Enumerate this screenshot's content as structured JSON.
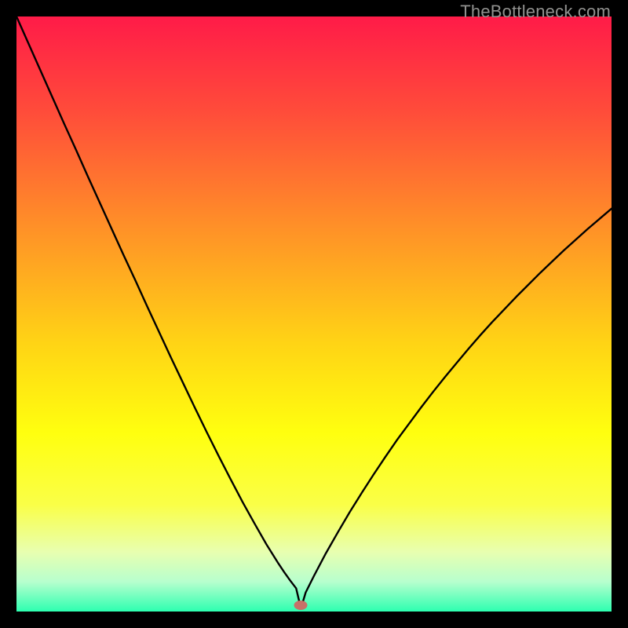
{
  "watermark": "TheBottleneck.com",
  "marker": {
    "x_pct": 47.8,
    "y_pct": 99.0,
    "color": "#c77168"
  },
  "gradient_stops": [
    {
      "pct": 0,
      "color": "#ff1b48"
    },
    {
      "pct": 16,
      "color": "#ff4c3a"
    },
    {
      "pct": 35,
      "color": "#ff8f28"
    },
    {
      "pct": 55,
      "color": "#ffd415"
    },
    {
      "pct": 70,
      "color": "#ffff0f"
    },
    {
      "pct": 82,
      "color": "#faff47"
    },
    {
      "pct": 90,
      "color": "#e8ffb0"
    },
    {
      "pct": 95,
      "color": "#b7ffce"
    },
    {
      "pct": 100,
      "color": "#2dffb0"
    }
  ],
  "chart_data": {
    "type": "line",
    "title": "",
    "xlabel": "",
    "ylabel": "",
    "xlim": [
      0,
      100
    ],
    "ylim": [
      0,
      100
    ],
    "x": [
      0,
      2,
      4,
      6,
      8,
      10,
      12,
      14,
      16,
      18,
      20,
      22,
      24,
      26,
      28,
      30,
      32,
      34,
      36,
      38,
      40,
      42,
      43,
      44,
      45,
      46,
      47,
      47.8,
      48.6,
      50,
      52,
      54,
      56,
      58,
      60,
      62,
      64,
      66,
      68,
      70,
      72,
      74,
      76,
      78,
      80,
      82,
      84,
      86,
      88,
      90,
      92,
      94,
      96,
      98,
      100
    ],
    "values": [
      100,
      95.5,
      91,
      86.5,
      82,
      77.6,
      73.1,
      68.7,
      64.3,
      59.9,
      55.6,
      51.2,
      46.9,
      42.6,
      38.4,
      34.2,
      30.1,
      26.1,
      22.2,
      18.4,
      14.8,
      11.3,
      9.7,
      8.1,
      6.6,
      5.2,
      3.9,
      0.5,
      3.2,
      6.0,
      9.8,
      13.3,
      16.7,
      19.9,
      23.0,
      26.0,
      28.9,
      31.6,
      34.3,
      36.9,
      39.4,
      41.8,
      44.2,
      46.5,
      48.7,
      50.8,
      52.9,
      54.9,
      56.9,
      58.8,
      60.7,
      62.5,
      64.3,
      66.0,
      67.7
    ],
    "minimum_point_x_pct": 47.8
  }
}
